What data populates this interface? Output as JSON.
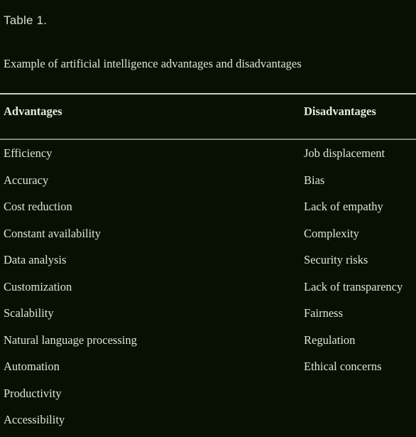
{
  "document": {
    "background_color": "#081003",
    "text_color": "#dfe3de",
    "rule_color_top": "#c9cec6",
    "rule_color_header": "#7d8a78"
  },
  "table": {
    "number_label": "Table 1.",
    "caption": "Example of artificial intelligence advantages and disadvantages",
    "columns": [
      {
        "key": "advantages",
        "header": "Advantages"
      },
      {
        "key": "disadvantages",
        "header": "Disadvantages"
      }
    ],
    "rows": [
      {
        "advantages": "Efficiency",
        "disadvantages": "Job displacement"
      },
      {
        "advantages": "Accuracy",
        "disadvantages": "Bias"
      },
      {
        "advantages": "Cost reduction",
        "disadvantages": "Lack of empathy"
      },
      {
        "advantages": "Constant availability",
        "disadvantages": "Complexity"
      },
      {
        "advantages": "Data analysis",
        "disadvantages": "Security risks"
      },
      {
        "advantages": "Customization",
        "disadvantages": "Lack of transparency"
      },
      {
        "advantages": "Scalability",
        "disadvantages": "Fairness"
      },
      {
        "advantages": "Natural language processing",
        "disadvantages": "Regulation"
      },
      {
        "advantages": "Automation",
        "disadvantages": "Ethical concerns"
      },
      {
        "advantages": "Productivity",
        "disadvantages": ""
      },
      {
        "advantages": "Accessibility",
        "disadvantages": ""
      }
    ]
  }
}
